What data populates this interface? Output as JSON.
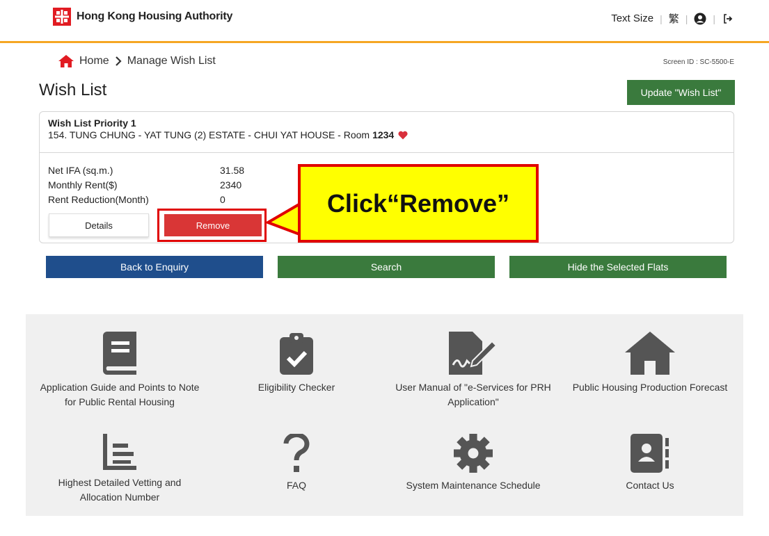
{
  "header": {
    "org_name": "Hong Kong Housing Authority",
    "text_size_label": "Text Size",
    "language_label": "繁",
    "icons": [
      "account-icon",
      "logout-icon"
    ]
  },
  "breadcrumb": {
    "home": "Home",
    "current": "Manage Wish List"
  },
  "screen_id": "Screen ID : SC-5500-E",
  "page_title": "Wish List",
  "update_button": "Update \"Wish List\"",
  "wish_item": {
    "priority_label": "Wish List Priority 1",
    "flat_prefix": "154. TUNG CHUNG - YAT TUNG (2) ESTATE - CHUI YAT HOUSE - Room",
    "room_number": "1234",
    "fields": [
      {
        "label": "Net IFA (sq.m.)",
        "value": "31.58"
      },
      {
        "label": "Monthly Rent($)",
        "value": "2340"
      },
      {
        "label": "Rent Reduction(Month)",
        "value": "0"
      }
    ],
    "details_button": "Details",
    "remove_button": "Remove"
  },
  "callout_text": "Click“Remove”",
  "actions": {
    "back": "Back to Enquiry",
    "search": "Search",
    "hide": "Hide the Selected Flats"
  },
  "footer_links": [
    {
      "label": "Application Guide and Points to Note for Public Rental Housing",
      "icon": "book-icon"
    },
    {
      "label": "Eligibility Checker",
      "icon": "clipboard-check-icon"
    },
    {
      "label": "User Manual of \"e-Services for PRH Application\"",
      "icon": "document-sign-icon"
    },
    {
      "label": "Public Housing Production Forecast",
      "icon": "house-icon"
    },
    {
      "label": "Highest Detailed Vetting and Allocation Number",
      "icon": "bar-list-icon"
    },
    {
      "label": "FAQ",
      "icon": "question-icon"
    },
    {
      "label": "System Maintenance Schedule",
      "icon": "gear-icon"
    },
    {
      "label": "Contact Us",
      "icon": "contact-book-icon"
    }
  ],
  "colors": {
    "accent_orange": "#f5a623",
    "primary_green": "#3a7a3d",
    "primary_blue": "#1f4e8c",
    "remove_red": "#d93636",
    "callout_yellow": "#ffff00"
  }
}
